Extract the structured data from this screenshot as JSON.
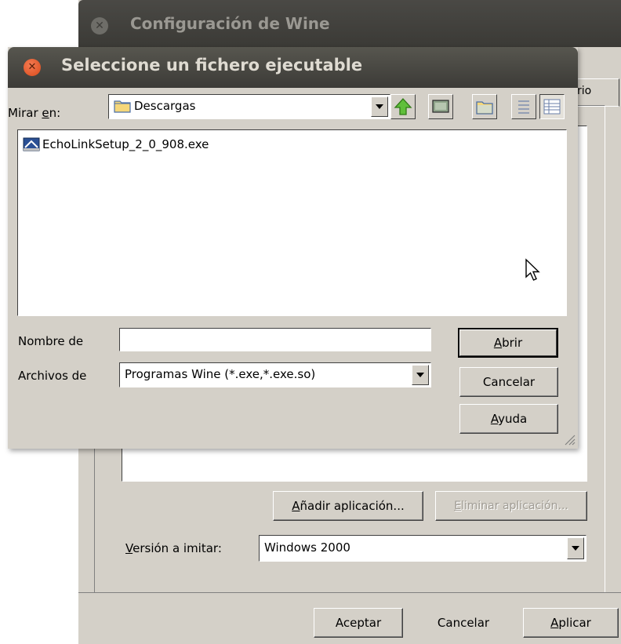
{
  "back_window": {
    "title": "Configuración de Wine",
    "partial_tab_label": "rio",
    "add_app_button": {
      "pre": "",
      "accel": "A",
      "post": "ñadir aplicación..."
    },
    "remove_app_button": {
      "pre": "",
      "accel": "E",
      "post": "liminar aplicación..."
    },
    "version_label": {
      "accel": "V",
      "post": "ersión a imitar:"
    },
    "version_value": "Windows 2000",
    "ok_button": "Aceptar",
    "cancel_button": "Cancelar",
    "apply_button": {
      "accel": "A",
      "post": "plicar"
    }
  },
  "dialog": {
    "title": "Seleccione un fichero ejecutable",
    "lookin_label": {
      "pre": "Mirar ",
      "accel": "e",
      "post": "n:"
    },
    "lookin_value": "Descargas",
    "files": [
      {
        "name": "EchoLinkSetup_2_0_908.exe",
        "icon": "exe-installer-icon"
      }
    ],
    "filename_label": "Nombre de",
    "filename_value": "",
    "filetype_label": "Archivos de",
    "filetype_value": "Programas Wine (*.exe,*.exe.so)",
    "open_button": {
      "accel": "A",
      "post": "brir"
    },
    "cancel_button": "Cancelar",
    "help_button": {
      "accel": "A",
      "post": "yuda"
    },
    "toolbar_icons": [
      "up-folder-icon",
      "desktop-icon",
      "new-folder-icon",
      "list-view-icon",
      "details-view-icon"
    ]
  }
}
